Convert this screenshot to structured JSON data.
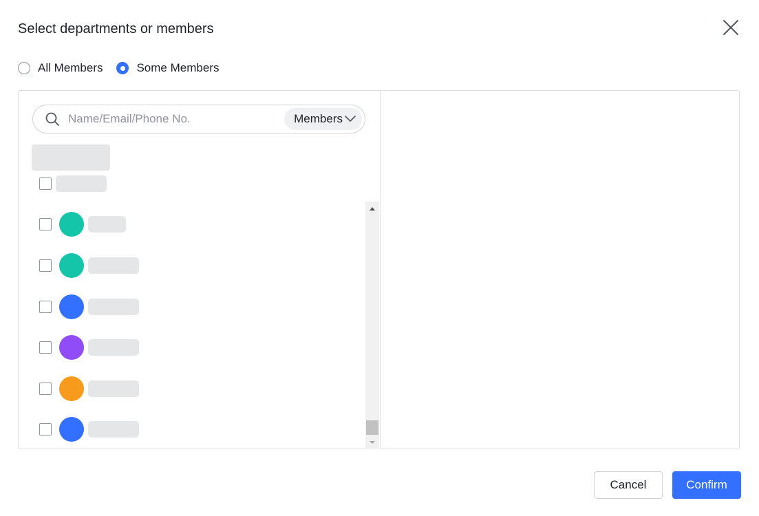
{
  "dialog": {
    "title": "Select departments or members",
    "close_icon": "close-icon"
  },
  "scope": {
    "options": [
      {
        "label": "All Members",
        "checked": false
      },
      {
        "label": "Some Members",
        "checked": true
      }
    ]
  },
  "search": {
    "placeholder": "Name/Email/Phone No.",
    "value": "",
    "icon": "search-icon",
    "filter_label": "Members",
    "filter_icon": "chevron-down-icon"
  },
  "members": [
    {
      "avatar_color": "#14c5a9"
    },
    {
      "avatar_color": "#14c5a9"
    },
    {
      "avatar_color": "#3370ff"
    },
    {
      "avatar_color": "#8f4cf7"
    },
    {
      "avatar_color": "#f89b1c"
    },
    {
      "avatar_color": "#3370ff"
    }
  ],
  "footer": {
    "cancel_label": "Cancel",
    "confirm_label": "Confirm"
  },
  "colors": {
    "accent": "#3370ff",
    "skeleton": "#e5e6e8",
    "border": "#dee0e3"
  }
}
